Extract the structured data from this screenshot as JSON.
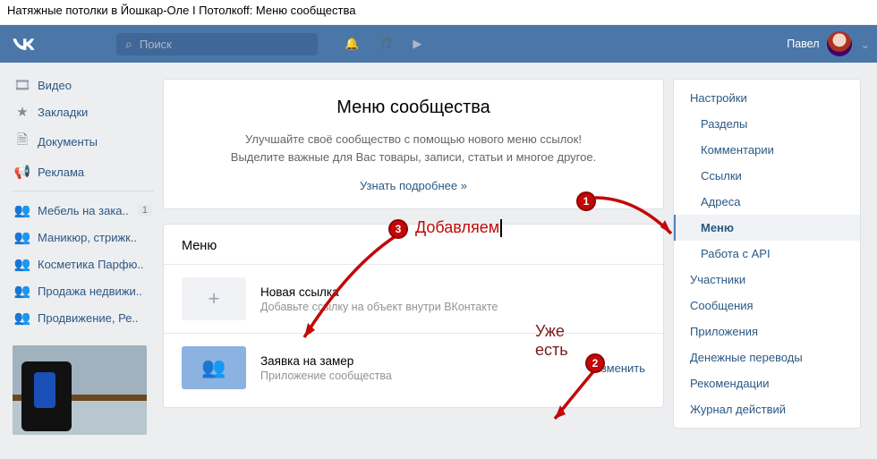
{
  "browser_title": "Натяжные потолки в Йошкар-Оле I Потолкoff: Меню сообщества",
  "search": {
    "placeholder": "Поиск"
  },
  "user": {
    "name": "Павел"
  },
  "left_nav": {
    "items": [
      {
        "icon": "🎞",
        "label": "Видео"
      },
      {
        "icon": "★",
        "label": "Закладки"
      },
      {
        "icon": "🗎",
        "label": "Документы"
      },
      {
        "icon": "📢",
        "label": "Реклама"
      }
    ],
    "groups": [
      {
        "label": "Мебель на зака..",
        "badge": "1"
      },
      {
        "label": "Маникюр, стрижк.."
      },
      {
        "label": "Косметика Парфю.."
      },
      {
        "label": "Продажа недвижи.."
      },
      {
        "label": "Продвижение, Ре.."
      }
    ]
  },
  "intro": {
    "title": "Меню сообщества",
    "line1": "Улучшайте своё сообщество с помощью нового меню ссылок!",
    "line2": "Выделите важные для Вас товары, записи, статьи и многое другое.",
    "learn_more": "Узнать подробнее »"
  },
  "menu_card": {
    "header": "Меню",
    "items": [
      {
        "icon": "+",
        "title": "Новая ссылка",
        "subtitle": "Добавьте ссылку на объект внутри ВКонтакте",
        "action": ""
      },
      {
        "icon": "👥",
        "title": "Заявка на замер",
        "subtitle": "Приложение сообщества",
        "action": "Изменить"
      }
    ]
  },
  "right_nav": {
    "items": [
      {
        "label": "Настройки",
        "level": 0,
        "selected": false
      },
      {
        "label": "Разделы",
        "level": 1,
        "selected": false
      },
      {
        "label": "Комментарии",
        "level": 1,
        "selected": false
      },
      {
        "label": "Ссылки",
        "level": 1,
        "selected": false
      },
      {
        "label": "Адреса",
        "level": 1,
        "selected": false
      },
      {
        "label": "Меню",
        "level": 1,
        "selected": true
      },
      {
        "label": "Работа с API",
        "level": 1,
        "selected": false
      },
      {
        "label": "Участники",
        "level": 0,
        "selected": false
      },
      {
        "label": "Сообщения",
        "level": 0,
        "selected": false
      },
      {
        "label": "Приложения",
        "level": 0,
        "selected": false
      },
      {
        "label": "Денежные переводы",
        "level": 0,
        "selected": false
      },
      {
        "label": "Рекомендации",
        "level": 0,
        "selected": false
      },
      {
        "label": "Журнал действий",
        "level": 0,
        "selected": false
      }
    ]
  },
  "annotations": {
    "badge1": "1",
    "badge2": "2",
    "badge3": "3",
    "text_add": "Добавляем",
    "text_exists_l1": "Уже",
    "text_exists_l2": "есть"
  }
}
